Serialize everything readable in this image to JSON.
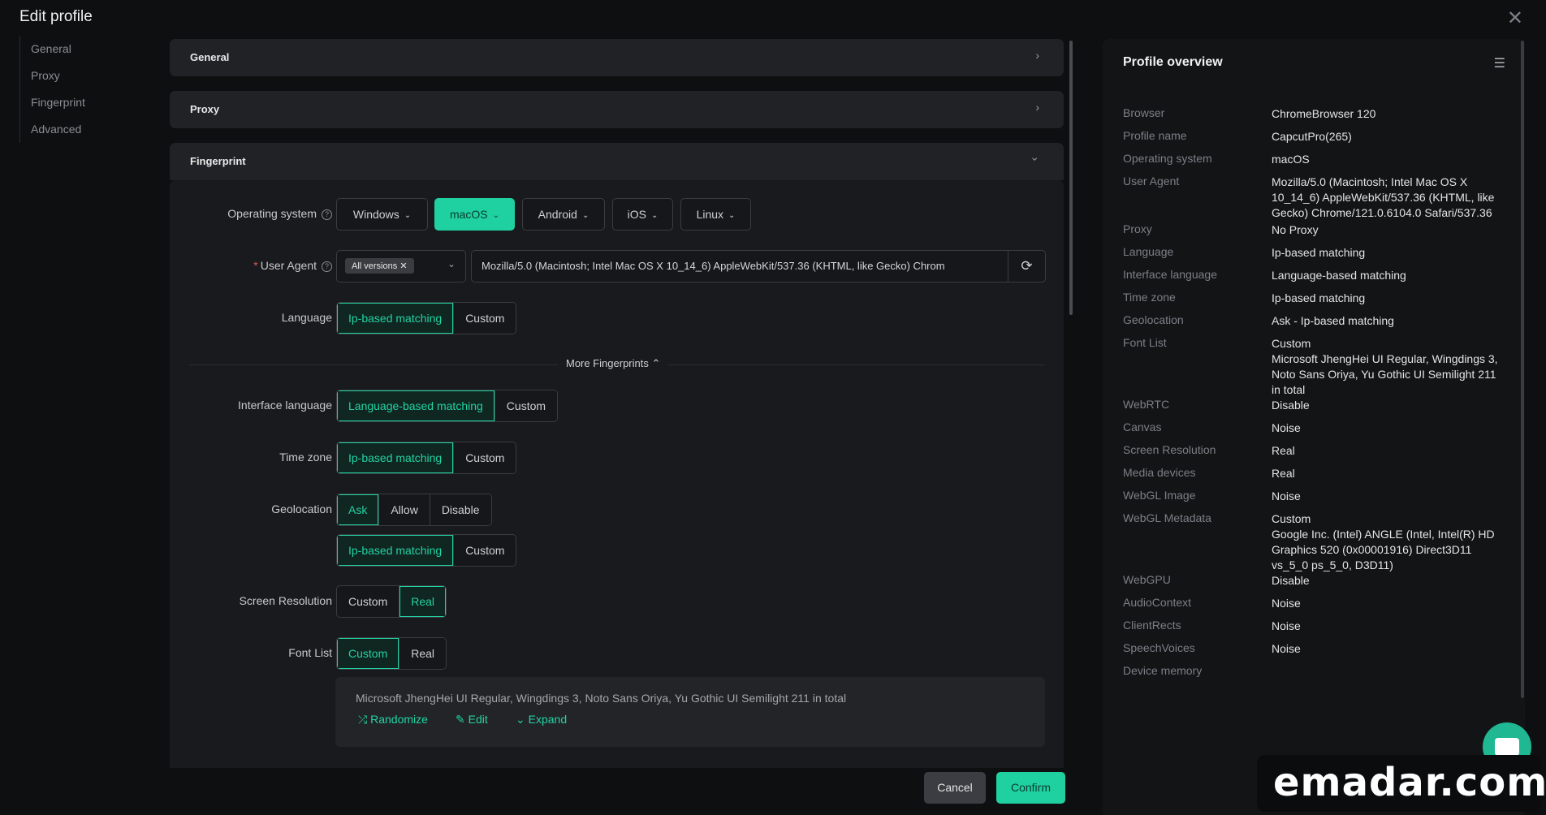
{
  "header": {
    "title": "Edit profile",
    "close": "✕"
  },
  "nav": {
    "items": [
      "General",
      "Proxy",
      "Fingerprint",
      "Advanced"
    ]
  },
  "sections": {
    "general": "General",
    "proxy": "Proxy",
    "fingerprint": "Fingerprint"
  },
  "form": {
    "os_label": "Operating system",
    "os_options": [
      "Windows",
      "macOS",
      "Android",
      "iOS",
      "Linux"
    ],
    "os_selected": "macOS",
    "ua_label": "User Agent",
    "ua_tag": "All versions",
    "ua_value": "Mozilla/5.0 (Macintosh; Intel Mac OS X 10_14_6) AppleWebKit/537.36 (KHTML, like Gecko) Chrom",
    "language_label": "Language",
    "language_options": [
      "Ip-based matching",
      "Custom"
    ],
    "more_fingerprints": "More Fingerprints",
    "interface_language_label": "Interface language",
    "interface_language_options": [
      "Language-based matching",
      "Custom"
    ],
    "timezone_label": "Time zone",
    "timezone_options": [
      "Ip-based matching",
      "Custom"
    ],
    "geolocation_label": "Geolocation",
    "geolocation_options": [
      "Ask",
      "Allow",
      "Disable"
    ],
    "geolocation_sub_options": [
      "Ip-based matching",
      "Custom"
    ],
    "screen_label": "Screen Resolution",
    "screen_options": [
      "Custom",
      "Real"
    ],
    "font_label": "Font List",
    "font_options": [
      "Custom",
      "Real"
    ],
    "font_text": "Microsoft JhengHei UI Regular, Wingdings 3, Noto Sans Oriya, Yu Gothic UI Semilight 211 in total",
    "font_actions": [
      "Randomize",
      "Edit",
      "Expand"
    ]
  },
  "footer": {
    "cancel": "Cancel",
    "confirm": "Confirm"
  },
  "overview": {
    "title": "Profile overview",
    "rows": [
      {
        "k": "Browser",
        "v": "ChromeBrowser 120"
      },
      {
        "k": "Profile name",
        "v": "CapcutPro(265)"
      },
      {
        "k": "Operating system",
        "v": "macOS"
      },
      {
        "k": "User Agent",
        "v": "Mozilla/5.0 (Macintosh; Intel Mac OS X\n10_14_6) AppleWebKit/537.36 (KHTML, like\nGecko) Chrome/121.0.6104.0 Safari/537.36"
      },
      {
        "k": "Proxy",
        "v": "No Proxy"
      },
      {
        "k": "Language",
        "v": "Ip-based matching"
      },
      {
        "k": "Interface language",
        "v": "Language-based matching"
      },
      {
        "k": "Time zone",
        "v": "Ip-based matching"
      },
      {
        "k": "Geolocation",
        "v": "Ask - Ip-based matching"
      },
      {
        "k": "Font List",
        "v": "Custom\nMicrosoft JhengHei UI Regular, Wingdings 3,\nNoto Sans Oriya, Yu Gothic UI Semilight 211\nin total"
      },
      {
        "k": "WebRTC",
        "v": "Disable"
      },
      {
        "k": "Canvas",
        "v": "Noise"
      },
      {
        "k": "Screen Resolution",
        "v": "Real"
      },
      {
        "k": "Media devices",
        "v": "Real"
      },
      {
        "k": "WebGL Image",
        "v": "Noise"
      },
      {
        "k": "WebGL Metadata",
        "v": "Custom\nGoogle Inc. (Intel) ANGLE (Intel, Intel(R) HD\nGraphics 520 (0x00001916) Direct3D11\nvs_5_0 ps_5_0, D3D11)"
      },
      {
        "k": "WebGPU",
        "v": "Disable"
      },
      {
        "k": "AudioContext",
        "v": "Noise"
      },
      {
        "k": "ClientRects",
        "v": "Noise"
      },
      {
        "k": "SpeechVoices",
        "v": "Noise"
      },
      {
        "k": "Device memory",
        "v": ""
      }
    ]
  },
  "watermark": "emadar.com"
}
